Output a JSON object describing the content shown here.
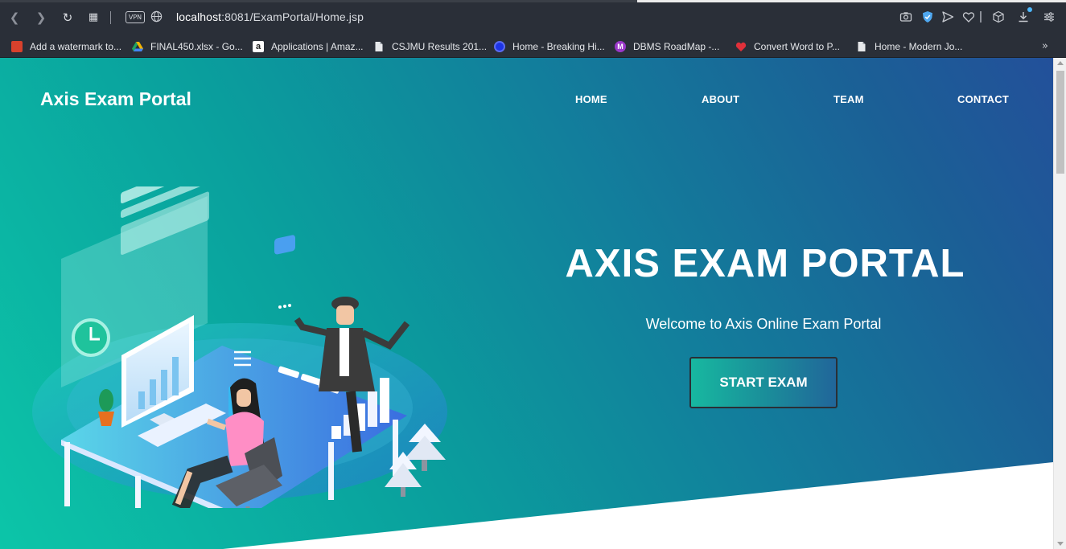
{
  "browser": {
    "url_host": "localhost",
    "url_rest": ":8081/ExamPortal/Home.jsp",
    "vpn_label": "VPN",
    "bookmarks": [
      {
        "label": "Add a watermark to...",
        "icon_color": "#c8321e",
        "icon": "pdf24-icon"
      },
      {
        "label": "FINAL450.xlsx - Go...",
        "icon_color": "#f5b400",
        "icon": "google-drive-icon"
      },
      {
        "label": "Applications | Amaz...",
        "icon_color": "#ffffff",
        "icon": "amazon-icon"
      },
      {
        "label": "CSJMU Results 201...",
        "icon_color": "#e6e8eb",
        "icon": "page-icon"
      },
      {
        "label": "Home - Breaking Hi...",
        "icon_color": "#1d34e6",
        "icon": "globe-badge-icon"
      },
      {
        "label": "DBMS RoadMap -...",
        "icon_color": "#9b38c9",
        "icon": "m-badge-icon"
      },
      {
        "label": "Convert Word to P...",
        "icon_color": "#e0303a",
        "icon": "heart-icon"
      },
      {
        "label": "Home - Modern Jo...",
        "icon_color": "#e6e8eb",
        "icon": "page-icon"
      }
    ],
    "more_glyph": "»"
  },
  "page": {
    "brand": "Axis Exam Portal",
    "nav": [
      "HOME",
      "ABOUT",
      "TEAM",
      "CONTACT"
    ],
    "hero_title": "AXIS EXAM PORTAL",
    "hero_subtitle": "Welcome to Axis Online Exam Portal",
    "cta_label": "START EXAM",
    "colors": {
      "gradient_start": "#0cc5a8",
      "gradient_end": "#23509a",
      "text": "#ffffff"
    }
  }
}
